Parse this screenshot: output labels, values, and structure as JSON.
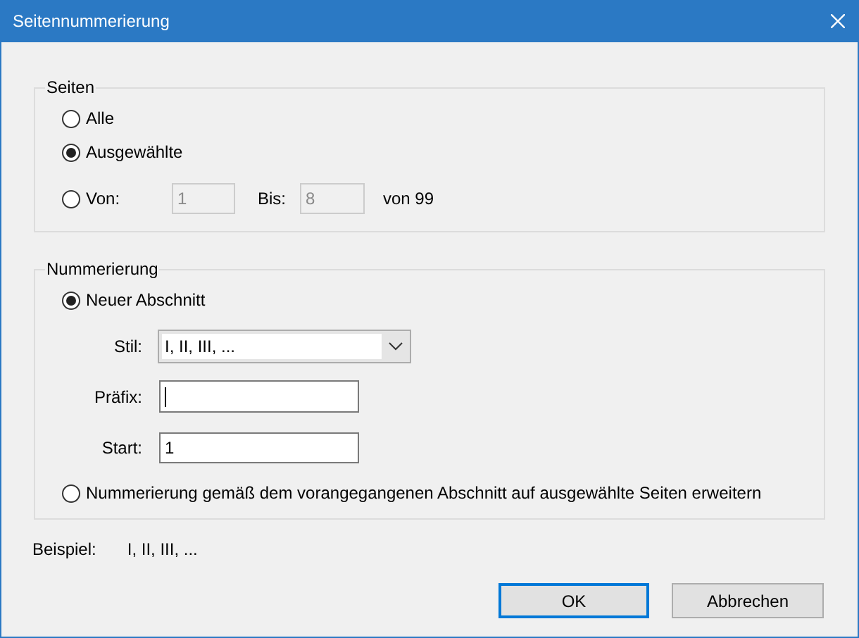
{
  "window": {
    "title": "Seitennummerierung"
  },
  "pages": {
    "legend": "Seiten",
    "options": [
      {
        "label": "Alle",
        "selected": false
      },
      {
        "label": "Ausgewählte",
        "selected": true
      },
      {
        "label": "Von:",
        "selected": false
      }
    ],
    "range": {
      "from": {
        "value": "1",
        "disabled": true
      },
      "to_label": "Bis:",
      "to": {
        "value": "8",
        "disabled": true
      },
      "total": "von 99"
    }
  },
  "numbering": {
    "legend": "Nummerierung",
    "options": [
      {
        "label": "Neuer Abschnitt",
        "selected": true
      },
      {
        "label": "Nummerierung gemäß dem vorangegangenen Abschnitt auf ausgewählte Seiten erweitern",
        "selected": false
      }
    ],
    "style": {
      "label": "Stil:",
      "value": "I, II, III, ..."
    },
    "prefix": {
      "label": "Präfix:",
      "focused": true
    },
    "start": {
      "label": "Start:",
      "value": "1"
    }
  },
  "example": {
    "label": "Beispiel:",
    "value": "I, II, III, ..."
  },
  "buttons": [
    {
      "label": "OK",
      "default": true
    },
    {
      "label": "Abbrechen",
      "default": false
    }
  ]
}
